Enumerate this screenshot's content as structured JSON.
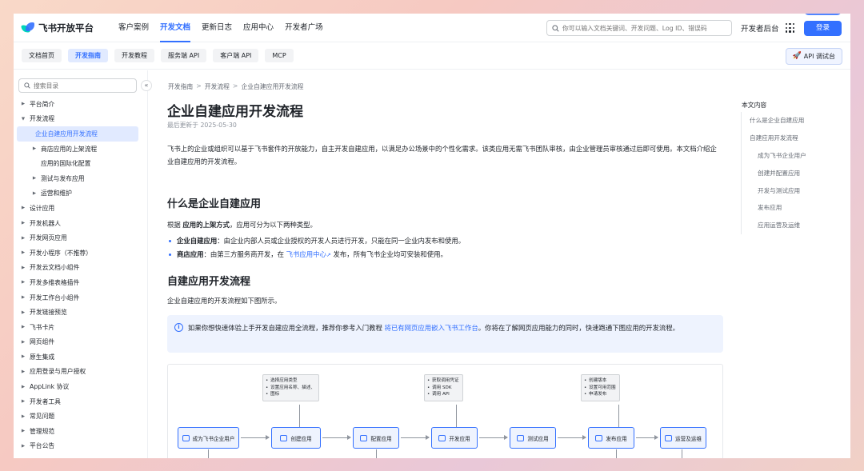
{
  "brand": {
    "name": "飞书开放平台"
  },
  "topnav": {
    "links": [
      "客户案例",
      "开发文档",
      "更新日志",
      "应用中心",
      "开发者广场"
    ],
    "active_index": 1,
    "search_placeholder": "你可以输入文档关键词、开发问题、Log ID、错误码",
    "dev_console": "开发者后台",
    "login": "登录"
  },
  "subnav": {
    "tabs": [
      "文档首页",
      "开发指南",
      "开发教程",
      "服务端 API",
      "客户端 API",
      "MCP"
    ],
    "active_index": 1,
    "api_debug": "API 调试台"
  },
  "sidebar": {
    "search_placeholder": "搜索目录",
    "items": [
      {
        "label": "平台简介",
        "level": 0,
        "caret": "right"
      },
      {
        "label": "开发流程",
        "level": 0,
        "caret": "down"
      },
      {
        "label": "企业自建应用开发流程",
        "level": 1,
        "caret": "none",
        "active": true
      },
      {
        "label": "商店应用的上架流程",
        "level": 1,
        "caret": "right"
      },
      {
        "label": "应用的国际化配置",
        "level": 1,
        "caret": "none"
      },
      {
        "label": "测试与发布应用",
        "level": 1,
        "caret": "right"
      },
      {
        "label": "运营和维护",
        "level": 1,
        "caret": "right"
      },
      {
        "label": "设计应用",
        "level": 0,
        "caret": "right"
      },
      {
        "label": "开发机器人",
        "level": 0,
        "caret": "right"
      },
      {
        "label": "开发网页应用",
        "level": 0,
        "caret": "right"
      },
      {
        "label": "开发小程序（不推荐）",
        "level": 0,
        "caret": "right"
      },
      {
        "label": "开发云文档小组件",
        "level": 0,
        "caret": "right"
      },
      {
        "label": "开发多维表格插件",
        "level": 0,
        "caret": "right"
      },
      {
        "label": "开发工作台小组件",
        "level": 0,
        "caret": "right"
      },
      {
        "label": "开发链接预览",
        "level": 0,
        "caret": "right"
      },
      {
        "label": "飞书卡片",
        "level": 0,
        "caret": "right"
      },
      {
        "label": "网页组件",
        "level": 0,
        "caret": "right"
      },
      {
        "label": "原生集成",
        "level": 0,
        "caret": "right"
      },
      {
        "label": "应用登录与用户授权",
        "level": 0,
        "caret": "right"
      },
      {
        "label": "AppLink 协议",
        "level": 0,
        "caret": "right"
      },
      {
        "label": "开发者工具",
        "level": 0,
        "caret": "right"
      },
      {
        "label": "常见问题",
        "level": 0,
        "caret": "right"
      },
      {
        "label": "管理规范",
        "level": 0,
        "caret": "right"
      },
      {
        "label": "平台公告",
        "level": 0,
        "caret": "right"
      }
    ]
  },
  "main": {
    "breadcrumb": [
      "开发指南",
      "开发流程",
      "企业自建应用开发流程"
    ],
    "title": "企业自建应用开发流程",
    "updated": "最后更新于 2025-05-30",
    "intro": "飞书上的企业或组织可以基于飞书套件的开放能力，自主开发自建应用，以满足办公场景中的个性化需求。该类应用无需飞书团队审核，由企业管理员审核通过后即可使用。本文档介绍企业自建应用的开发流程。",
    "section1": {
      "heading": "什么是企业自建应用",
      "lead_prefix": "根据 ",
      "lead_bold": "应用的上架方式",
      "lead_suffix": "，应用可分为以下两种类型。",
      "bullet1_bold": "企业自建应用",
      "bullet1_text": "：由企业内部人员或企业授权的开发人员进行开发，只能在同一企业内发布和使用。",
      "bullet2_bold": "商店应用",
      "bullet2_prefix": "：由第三方服务商开发，在 ",
      "bullet2_link": "飞书应用中心",
      "bullet2_suffix": " 发布，所有飞书企业均可安装和使用。"
    },
    "section2": {
      "heading": "自建应用开发流程",
      "lead": "企业自建应用的开发流程如下图所示。",
      "callout_prefix": "如果你想快速体验上手开发自建应用全流程，推荐你参考入门教程 ",
      "callout_link": "将已有网页应用嵌入飞书工作台",
      "callout_suffix": "。你将在了解网页应用能力的同时，快速跑通下图应用的开发流程。"
    },
    "diagram": {
      "notes": [
        [
          "选择应用类型",
          "设置应用名称、描述、",
          "图标"
        ],
        [
          "获取调用凭证",
          "调用 SDK",
          "调用 API"
        ],
        [
          "创建版本",
          "设置可用范围",
          "申请发布"
        ]
      ],
      "steps": [
        "成为飞书企业用户",
        "创建应用",
        "配置应用",
        "开发应用",
        "测试应用",
        "发布应用",
        "运营及运维"
      ]
    }
  },
  "toc": {
    "title": "本文内容",
    "items": [
      {
        "label": "什么是企业自建应用",
        "sub": false
      },
      {
        "label": "自建应用开发流程",
        "sub": false
      },
      {
        "label": "成为飞书企业用户",
        "sub": true
      },
      {
        "label": "创建并配置应用",
        "sub": true
      },
      {
        "label": "开发与测试应用",
        "sub": true
      },
      {
        "label": "发布应用",
        "sub": true
      },
      {
        "label": "应用运营及运维",
        "sub": true
      }
    ]
  }
}
